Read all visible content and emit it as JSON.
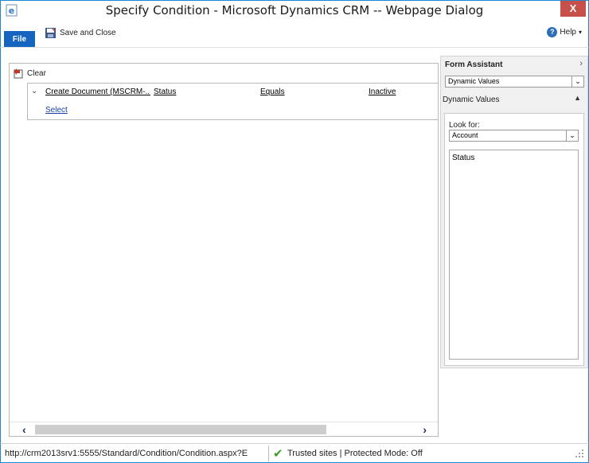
{
  "window": {
    "title": "Specify Condition - Microsoft Dynamics CRM -- Webpage Dialog",
    "close_glyph": "X"
  },
  "ribbon": {
    "file_label": "File",
    "save_close_label": "Save and Close",
    "help_label": "Help"
  },
  "condition": {
    "clear_label": "Clear",
    "row": {
      "entity": "Create Document (MSCRM-...",
      "field": "Status",
      "operator": "Equals",
      "value": "Inactive"
    },
    "select_label": "Select"
  },
  "assistant": {
    "title": "Form Assistant",
    "mode_dropdown": "Dynamic Values",
    "section_label": "Dynamic Values",
    "look_for_label": "Look for:",
    "look_for_value": "Account",
    "list_items": [
      "Status"
    ]
  },
  "statusbar": {
    "url": "http://crm2013srv1:5555/Standard/Condition/Condition.aspx?E",
    "zone": "Trusted sites | Protected Mode: Off"
  },
  "colors": {
    "frame_border": "#1c88d1",
    "file_tab": "#1565c0",
    "close_button": "#c7504a",
    "link": "#1a3ea8",
    "assistant_bg": "#f0f0f0"
  },
  "icons": {
    "browser": "ie-icon",
    "save": "save-icon",
    "help": "help-icon",
    "clear": "clear-icon",
    "trusted": "check-icon"
  }
}
